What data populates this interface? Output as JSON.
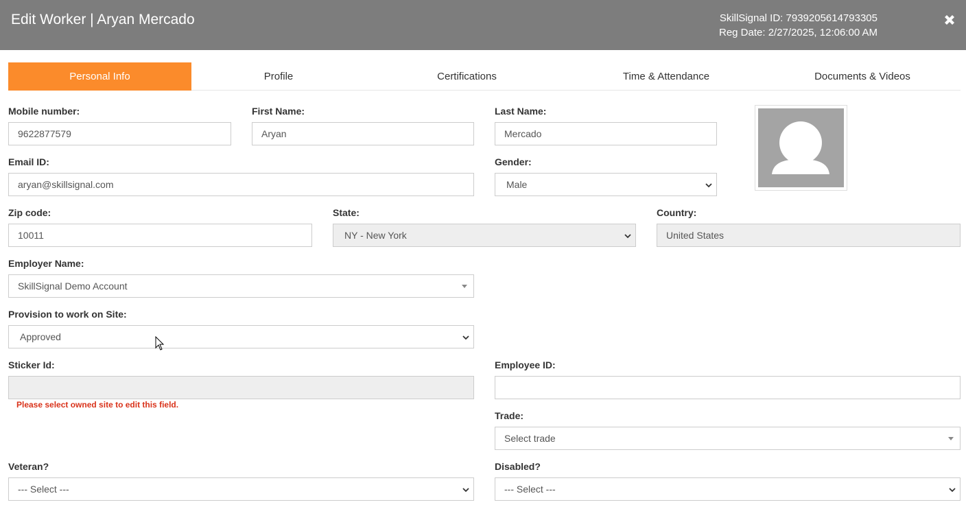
{
  "header": {
    "title": "Edit Worker | Aryan Mercado",
    "skillsignal_id": "SkillSignal ID: 7939205614793305",
    "reg_date": "Reg Date: 2/27/2025, 12:06:00 AM",
    "close_icon": "close-icon"
  },
  "tabs": [
    {
      "label": "Personal Info",
      "active": true
    },
    {
      "label": "Profile",
      "active": false
    },
    {
      "label": "Certifications",
      "active": false
    },
    {
      "label": "Time & Attendance",
      "active": false
    },
    {
      "label": "Documents & Videos",
      "active": false
    }
  ],
  "form": {
    "mobile": {
      "label": "Mobile number:",
      "value": "9622877579"
    },
    "first_name": {
      "label": "First Name:",
      "value": "Aryan"
    },
    "last_name": {
      "label": "Last Name:",
      "value": "Mercado"
    },
    "email": {
      "label": "Email ID:",
      "value": "aryan@skillsignal.com"
    },
    "gender": {
      "label": "Gender:",
      "value": "Male"
    },
    "zip": {
      "label": "Zip code:",
      "value": "10011"
    },
    "state": {
      "label": "State:",
      "value": "NY - New York"
    },
    "country": {
      "label": "Country:",
      "value": "United States"
    },
    "employer": {
      "label": "Employer Name:",
      "value": "SkillSignal Demo Account"
    },
    "provision": {
      "label": "Provision to work on Site:",
      "value": "Approved"
    },
    "sticker": {
      "label": "Sticker Id:",
      "value": "",
      "error": "Please select owned site to edit this field."
    },
    "employee_id": {
      "label": "Employee ID:",
      "value": ""
    },
    "trade": {
      "label": "Trade:",
      "value": "Select trade"
    },
    "veteran": {
      "label": "Veteran?",
      "value": "--- Select ---"
    },
    "disabled": {
      "label": "Disabled?",
      "value": "--- Select ---"
    }
  },
  "colors": {
    "header_bg": "#7d7d7d",
    "active_tab": "#fb8b2b",
    "error": "#d9321a"
  }
}
